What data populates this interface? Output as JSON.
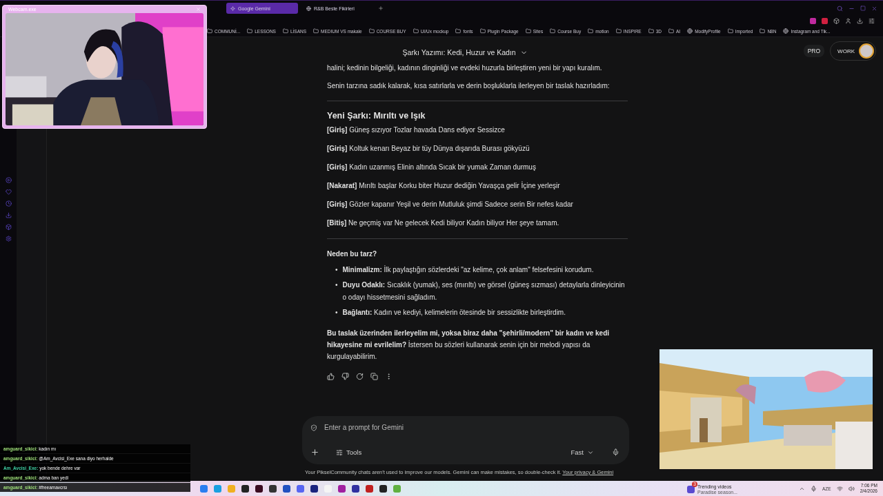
{
  "webcam_window": {
    "title": "Webcam.exe",
    "kind": "picture"
  },
  "browser": {
    "tabs": [
      {
        "label": "Google Gemini",
        "selected": true
      },
      {
        "label": "R&B Beste Fikirleri",
        "selected": false
      }
    ],
    "bookmarks": [
      {
        "label": "COMMUNİ...",
        "kind": "folder"
      },
      {
        "label": "LESSONS",
        "kind": "folder"
      },
      {
        "label": "LİSANS",
        "kind": "folder"
      },
      {
        "label": "MEDIUM VS makale",
        "kind": "folder"
      },
      {
        "label": "COURSE BUY",
        "kind": "folder"
      },
      {
        "label": "UI/Ux mockup",
        "kind": "folder"
      },
      {
        "label": "fonts",
        "kind": "folder"
      },
      {
        "label": "Plugin Package",
        "kind": "folder"
      },
      {
        "label": "Sites",
        "kind": "folder"
      },
      {
        "label": "Course Buy",
        "kind": "folder"
      },
      {
        "label": "motion",
        "kind": "folder"
      },
      {
        "label": "INSPIRE",
        "kind": "folder"
      },
      {
        "label": "3D",
        "kind": "folder"
      },
      {
        "label": "AI",
        "kind": "folder"
      },
      {
        "label": "ModifyProfile",
        "kind": "site"
      },
      {
        "label": "Imported",
        "kind": "folder"
      },
      {
        "label": "N8N",
        "kind": "folder"
      },
      {
        "label": "Instagram and Tik...",
        "kind": "site"
      }
    ]
  },
  "header": {
    "title": "Şarkı Yazımı: Kedi, Huzur ve Kadın",
    "plan": "PRO",
    "workspace": "WORK"
  },
  "response": {
    "intro": [
      "halini; kedinin bilgeliği, kadının dinginliği ve evdeki huzurla birleştiren yeni bir yapı kuralım.",
      "Senin tarzına sadık kalarak, kısa satırlarla ve derin boşluklarla ilerleyen bir taslak hazırladım:"
    ],
    "song_title": "Yeni Şarkı: Mırıltı ve Işık",
    "verses": [
      "**[Giriş]** Güneş sızıyor Tozlar havada Dans ediyor Sessizce",
      "**[Giriş]** Koltuk kenarı Beyaz bir tüy Dünya dışarıda Burası gökyüzü",
      "**[Giriş]** Kadın uzanmış Elinin altında Sıcak bir yumak Zaman durmuş",
      "**[Nakarat]** Mırıltı başlar Korku biter Huzur dediğin Yavaşça gelir İçine yerleşir",
      "**[Giriş]** Gözler kapanır Yeşil ve derin Mutluluk şimdi Sadece serin Bir nefes kadar",
      "**[Bitiş]** Ne geçmiş var Ne gelecek Kedi biliyor Kadın biliyor Her şeye tamam."
    ],
    "why_title": "Neden bu tarz?",
    "bullet": "•",
    "reasons": [
      "**Minimalizm:** İlk paylaştığın sözlerdeki \"az kelime, çok anlam\" felsefesini korudum.",
      "**Duyu Odaklı:** Sıcaklık (yumak), ses (mırıltı) ve görsel (güneş sızması) detaylarla dinleyicinin o odayı hissetmesini sağladım.",
      "**Bağlantı:** Kadın ve kediyi, kelimelerin ötesinde bir sessizlikte birleştirdim."
    ],
    "closing": "**Bu taslak üzerinden ilerleyelim mi, yoksa biraz daha \"şehirli/modern\" bir kadın ve kedi hikayesine mi evrilelim?** İstersen bu sözleri kullanarak senin için bir melodi yapısı da kurgulayabilirim."
  },
  "composer": {
    "placeholder": "Enter a prompt for Gemini",
    "tools": "Tools",
    "mode": "Fast"
  },
  "disclaimer": {
    "text": "Your PikselCommunity chats aren't used to improve our models. Gemini can make mistakes, so double-check it.",
    "link": "Your privacy & Gemini"
  },
  "chat": [
    {
      "user": "amguard_sikici:",
      "color": "#9fe07a",
      "text": "kadın mı"
    },
    {
      "user": "amguard_sikici:",
      "color": "#9fe07a",
      "text": "@Am_Avcisi_Exe sana diyo herhalde"
    },
    {
      "user": "Am_Avcisi_Exe:",
      "color": "#3fd0a4",
      "text": "yok bende dehre var"
    },
    {
      "user": "amguard_sikici:",
      "color": "#9fe07a",
      "text": "adma ban yedi"
    },
    {
      "user": "amguard_sikici:",
      "color": "#9fe07a",
      "text": "#freeamavcrsı"
    }
  ],
  "taskbar": {
    "widget_badge": "3",
    "widget_title": "Trending videos",
    "widget_subtitle": "Paradise season...",
    "language": "AZE",
    "time": "7:06 PM",
    "date": "2/4/2026"
  }
}
